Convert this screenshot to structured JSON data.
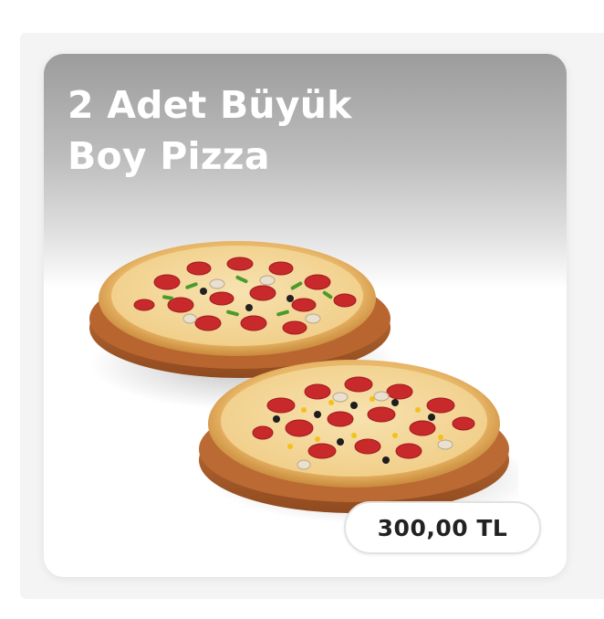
{
  "product": {
    "title_line1": "2 Adet Büyük",
    "title_line2": "Boy Pizza",
    "price": "300,00 TL",
    "image": "two-large-pizzas-on-wooden-boards"
  },
  "colors": {
    "title_text": "#ffffff",
    "price_text": "#222222",
    "card_gradient_top": "#9c9c9c",
    "card_bottom": "#ffffff"
  }
}
